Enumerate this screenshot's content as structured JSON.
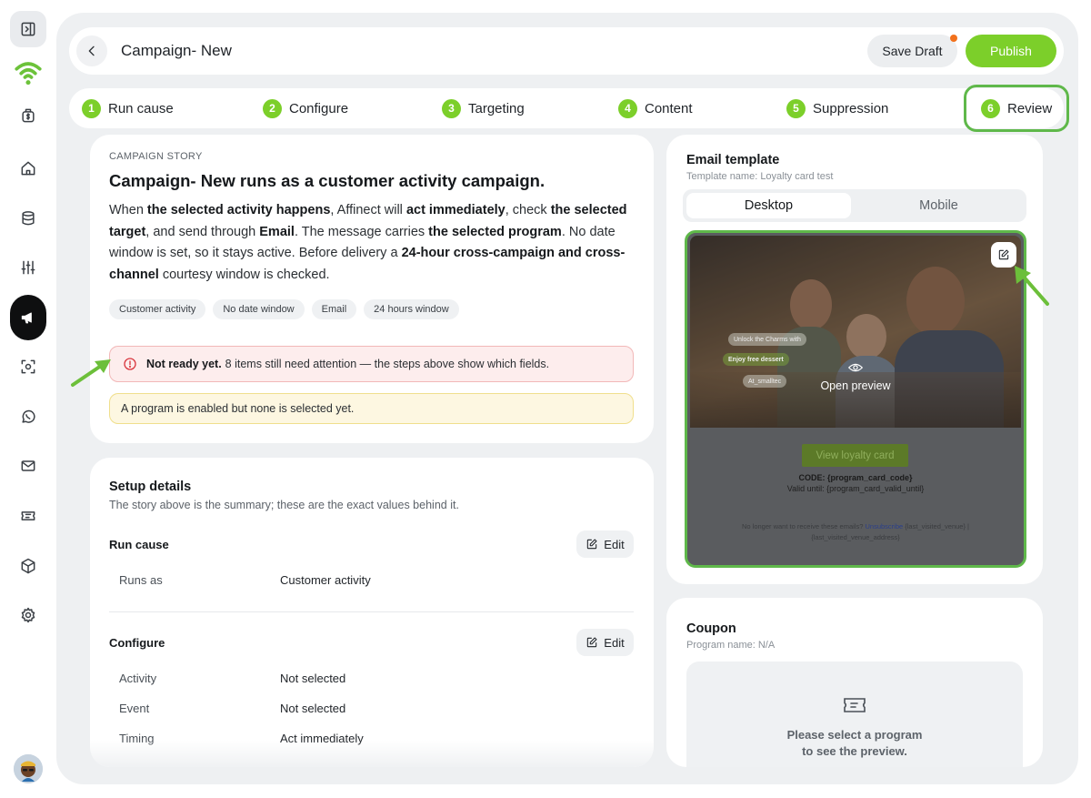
{
  "header": {
    "title": "Campaign- New",
    "save_draft": "Save Draft",
    "publish": "Publish"
  },
  "steps": [
    {
      "num": "1",
      "label": "Run cause"
    },
    {
      "num": "2",
      "label": "Configure"
    },
    {
      "num": "3",
      "label": "Targeting"
    },
    {
      "num": "4",
      "label": "Content"
    },
    {
      "num": "5",
      "label": "Suppression"
    },
    {
      "num": "6",
      "label": "Review"
    }
  ],
  "story": {
    "eyebrow": "CAMPAIGN STORY",
    "title": "Campaign- New runs as a customer activity campaign.",
    "p1": "When ",
    "b1": "the selected activity happens",
    "p2": ", Affinect will ",
    "b2": "act immediately",
    "p3": ", check ",
    "b3": "the selected target",
    "p4": ", and send through ",
    "b4": "Email",
    "p5": ". The message carries ",
    "b5": "the selected program",
    "p6": ". No date window is set, so it stays active. Before delivery a ",
    "b6": "24-hour cross-campaign and cross-channel",
    "p7": " courtesy window is checked.",
    "chips": [
      "Customer activity",
      "No date window",
      "Email",
      "24 hours window"
    ],
    "alert_bold": "Not ready yet.",
    "alert_text": "8 items still need attention — the steps above show which fields.",
    "warning": "A program is enabled but none is selected yet."
  },
  "setup": {
    "title": "Setup details",
    "subtitle": "The story above is the summary; these are the exact values behind it.",
    "edit_label": "Edit",
    "run_cause": {
      "title": "Run cause",
      "rows": [
        {
          "k": "Runs as",
          "v": "Customer activity"
        }
      ]
    },
    "configure": {
      "title": "Configure",
      "rows": [
        {
          "k": "Activity",
          "v": "Not selected"
        },
        {
          "k": "Event",
          "v": "Not selected"
        },
        {
          "k": "Timing",
          "v": "Act immediately"
        }
      ]
    }
  },
  "email": {
    "title": "Email template",
    "subtitle": "Template name: Loyalty card test",
    "tab_desktop": "Desktop",
    "tab_mobile": "Mobile",
    "open_preview": "Open preview",
    "chip_a": "Unlock the Charms with",
    "chip_b": "Enjoy free dessert",
    "chip_c": "At_smalltec",
    "button": "View loyalty card",
    "code": "CODE: {program_card_code}",
    "valid": "Valid until: {program_card_valid_until}",
    "footer_pre": "No longer want to receive these emails? ",
    "footer_link": "Unsubscribe",
    "footer_post": " {last_visited_venue} | {last_visited_venue_address}"
  },
  "coupon": {
    "title": "Coupon",
    "subtitle": "Program name: N/A",
    "msg1": "Please select a program",
    "msg2": "to see the preview."
  },
  "colors": {
    "accent": "#7ccf2a",
    "highlight": "#5fb84a",
    "notify_dot": "#f2711c"
  }
}
